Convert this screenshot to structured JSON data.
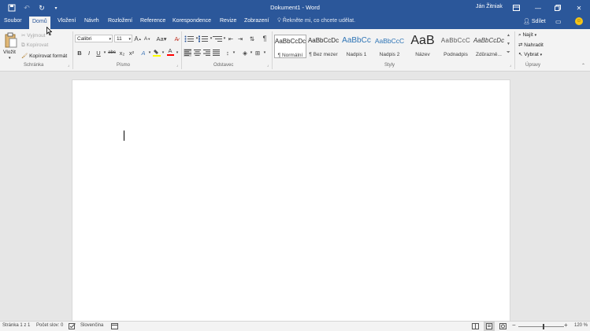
{
  "window": {
    "title": "Dokument1 - Word",
    "user": "Ján Žitniak",
    "quick_access": [
      "save-icon",
      "undo-icon",
      "redo-icon",
      "customize-icon"
    ],
    "controls": [
      "ribbon-display-icon",
      "minimize-icon",
      "restore-icon",
      "close-icon"
    ]
  },
  "tabs": {
    "file": "Soubor",
    "home": "Domů",
    "insert": "Vložení",
    "design": "Návrh",
    "layout": "Rozložení",
    "references": "Reference",
    "mailings": "Korespondence",
    "review": "Revize",
    "view": "Zobrazení",
    "tell_me": "Řekněte mi, co chcete udělat.",
    "share": "Sdílet"
  },
  "clipboard": {
    "paste": "Vložit",
    "cut": "Vyjmout",
    "copy": "Kopírovat",
    "format_painter": "Kopírovat formát",
    "label": "Schránka"
  },
  "font": {
    "name": "Calibri",
    "size": "11",
    "bold": "B",
    "italic": "I",
    "underline": "U",
    "strike": "abc",
    "subscript": "x₂",
    "superscript": "x²",
    "grow": "A",
    "shrink": "A",
    "case": "Aa",
    "font_color_letter": "A",
    "label": "Písmo"
  },
  "paragraph": {
    "label": "Odstavec"
  },
  "styles": {
    "items": [
      {
        "preview": "AaBbCcDc",
        "name": "¶ Normální"
      },
      {
        "preview": "AaBbCcDc",
        "name": "¶ Bez mezer"
      },
      {
        "preview": "AaBbCc",
        "name": "Nadpis 1"
      },
      {
        "preview": "AaBbCcC",
        "name": "Nadpis 2"
      },
      {
        "preview": "AaB",
        "name": "Název"
      },
      {
        "preview": "AaBbCcC",
        "name": "Podnadpis"
      },
      {
        "preview": "AaBbCcDc",
        "name": "Zdůrazně..."
      }
    ],
    "label": "Styly"
  },
  "editing": {
    "find": "Najít",
    "replace": "Nahradit",
    "select": "Vybrat",
    "label": "Úpravy"
  },
  "status": {
    "page": "Stránka 1 z 1",
    "words": "Počet slov: 0",
    "language": "Slovenčina",
    "zoom": "120 %",
    "zoom_level_fraction": 0.55
  },
  "colors": {
    "accent": "#2b579a",
    "highlight": "#ffff00",
    "font_color": "#ff0000"
  }
}
